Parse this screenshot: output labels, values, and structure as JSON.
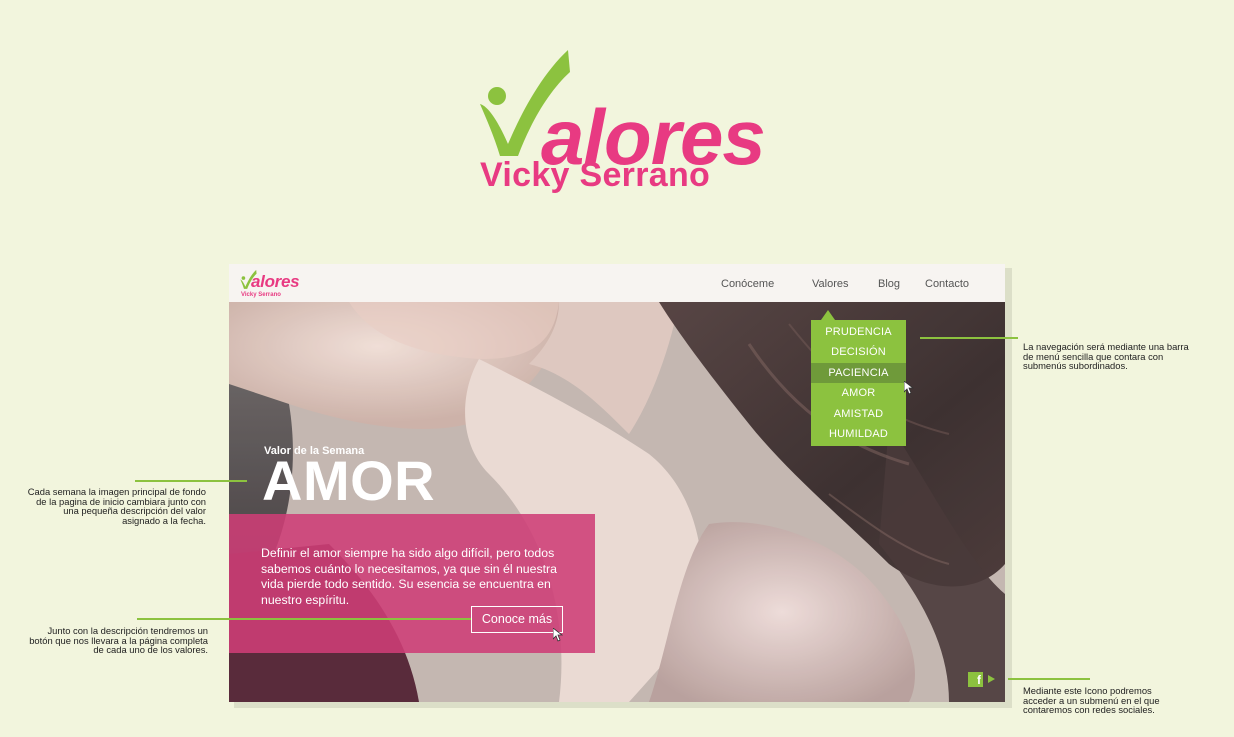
{
  "brand": {
    "logo_word": "alores",
    "logo_subtitle": "Vicky Serrano",
    "pink": "#e83a82",
    "green": "#8cc23f"
  },
  "mockup": {
    "logo_word": "alores",
    "logo_subtitle": "Vicky Serrano",
    "nav": [
      "Conóceme",
      "Valores",
      "Blog",
      "Contacto"
    ],
    "dropdown": {
      "items": [
        "PRUDENCIA",
        "DECISIÓN",
        "PACIENCIA",
        "AMOR",
        "AMISTAD",
        "HUMILDAD"
      ],
      "active_index": 2
    },
    "hero": {
      "kicker": "Valor de la Semana",
      "title": "AMOR",
      "description": "Definir el amor siempre ha sido algo difícil, pero todos sabemos cuánto lo necesitamos, ya que sin él nuestra vida pierde todo sentido. Su esencia se encuentra en nuestro espíritu.",
      "cta_label": "Conoce más"
    },
    "social": {
      "icons": [
        "facebook-icon",
        "play-arrow-icon"
      ]
    }
  },
  "annotations": {
    "nav": "La navegación será mediante una barra de menú sencilla que contara con submenús subordinados.",
    "weekly": "Cada semana la imagen principal de fondo de la pagina de inicio cambiara junto con una pequeña descripción del valor asignado a la fecha.",
    "button": "Junto con la descripción tendremos un botón que nos llevara a la página completa de cada uno de los valores.",
    "social": "Mediante este Icono podremos acceder a un submenú en el que contaremos con redes sociales."
  }
}
